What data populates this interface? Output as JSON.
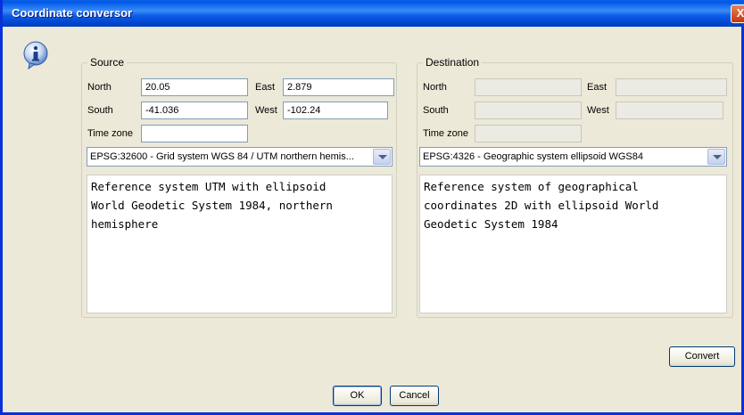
{
  "window": {
    "title": "Coordinate conversor",
    "close_label": "X"
  },
  "icons": {
    "info": "info-icon",
    "close": "close-icon",
    "dropdown": "chevron-down-icon"
  },
  "source": {
    "legend": "Source",
    "north_label": "North",
    "north_value": "20.05",
    "east_label": "East",
    "east_value": "2.879",
    "south_label": "South",
    "south_value": "-41.036",
    "west_label": "West",
    "west_value": "-102.24",
    "timezone_label": "Time zone",
    "timezone_value": "",
    "crs_selected": "EPSG:32600 - Grid system WGS 84 / UTM northern hemis...",
    "description": "Reference system UTM with ellipsoid\nWorld Geodetic System 1984, northern\nhemisphere"
  },
  "destination": {
    "legend": "Destination",
    "north_label": "North",
    "north_value": "",
    "east_label": "East",
    "east_value": "",
    "south_label": "South",
    "south_value": "",
    "west_label": "West",
    "west_value": "",
    "timezone_label": "Time zone",
    "timezone_value": "",
    "crs_selected": "EPSG:4326 - Geographic system ellipsoid WGS84",
    "description": "Reference system of geographical\ncoordinates 2D with ellipsoid World\nGeodetic System 1984"
  },
  "buttons": {
    "convert": "Convert",
    "ok": "OK",
    "cancel": "Cancel"
  },
  "colors": {
    "titlebar": "#0058e6",
    "window_bg": "#ece9d8",
    "field_border": "#7f9db9",
    "disabled_field": "#ebebe4"
  }
}
